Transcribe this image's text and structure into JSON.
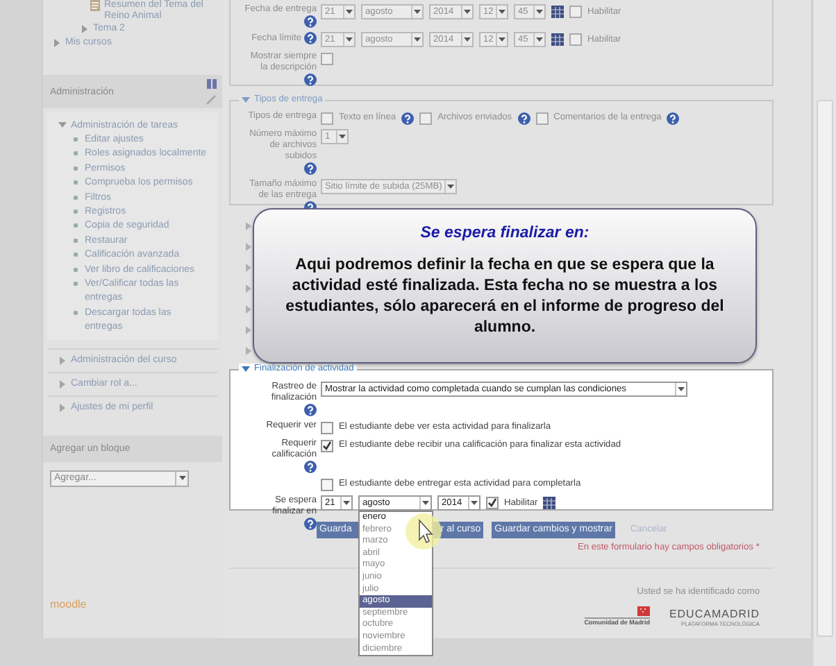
{
  "sidebar": {
    "nav_items": [
      {
        "kind": "resource",
        "label": "Resumen del Tema del Reino Animal"
      },
      {
        "kind": "topic",
        "label": "Tema 2",
        "expanded": false
      },
      {
        "kind": "branch",
        "label": "Mis cursos",
        "expanded": false
      }
    ],
    "admin_block": {
      "title": "Administración",
      "groups": [
        {
          "label": "Administración de tareas",
          "expanded": true,
          "children": [
            {
              "label": "Editar ajustes"
            },
            {
              "label": "Roles asignados localmente"
            },
            {
              "label": "Permisos"
            },
            {
              "label": "Comprueba los permisos"
            },
            {
              "label": "Filtros"
            },
            {
              "label": "Registros"
            },
            {
              "label": "Copia de seguridad"
            },
            {
              "label": "Restaurar"
            },
            {
              "label": "Calificación avanzada"
            },
            {
              "label": "Ver libro de calificaciones"
            },
            {
              "label": "Ver/Calificar todas las entregas"
            },
            {
              "label": "Descargar todas las entregas"
            }
          ]
        },
        {
          "label": "Administración del curso",
          "expanded": false
        },
        {
          "label": "Cambiar rol a...",
          "expanded": false
        },
        {
          "label": "Ajustes de mi perfil",
          "expanded": false
        }
      ]
    },
    "add_block": {
      "title": "Agregar un bloque",
      "select": "Agregar..."
    },
    "logo": "moodle"
  },
  "main": {
    "due_dates": {
      "rows": [
        {
          "label": "Fecha de entrega",
          "help": true,
          "day": "21",
          "month": "agosto",
          "year": "2014",
          "hour": "12",
          "minute": "45",
          "enabled": false,
          "enable_label": "Habilitar"
        },
        {
          "label": "Fecha límite",
          "help": true,
          "day": "21",
          "month": "agosto",
          "year": "2014",
          "hour": "12",
          "minute": "45",
          "enabled": false,
          "enable_label": "Habilitar"
        }
      ],
      "show_description": {
        "label": "Mostrar siempre la descripción",
        "help": true,
        "checked": false
      }
    },
    "submission_types": {
      "legend": "Tipos de entrega",
      "expanded": true,
      "types_label": "Tipos de entrega",
      "types": [
        {
          "label": "Texto en línea",
          "checked": false
        },
        {
          "label": "Archivos enviados",
          "checked": false
        },
        {
          "label": "Comentarios de la entrega",
          "checked": false
        }
      ],
      "max_files": {
        "label": "Número máximo de archivos subidos",
        "value": "1"
      },
      "max_size": {
        "label": "Tamaño máximo de las entrega",
        "value": "Sitio límite de subida (25MB)"
      }
    },
    "hidden_sections": [
      {
        "expanded": false
      },
      {
        "expanded": false
      },
      {
        "expanded": false
      },
      {
        "expanded": false
      },
      {
        "expanded": false
      },
      {
        "expanded": false
      },
      {
        "expanded": false
      }
    ],
    "tooltip": {
      "title": "Se espera finalizar en:",
      "body": "Aqui podremos definir la fecha en que se espera que la actividad esté finalizada. Esta fecha no se muestra a los estudiantes, sólo aparecerá en el informe de progreso del alumno."
    },
    "completion": {
      "legend": "Finalización de actividad",
      "expanded": true,
      "rows": [
        {
          "kind": "select",
          "label": "Rastreo de finalización",
          "help": true,
          "value": "Mostrar la actividad como completada cuando se cumplan las condiciones"
        },
        {
          "kind": "checkbox",
          "label": "Requerir ver",
          "help": false,
          "checked": false,
          "text": "El estudiante debe ver esta actividad para finalizarla"
        },
        {
          "kind": "checkbox",
          "label": "Requerir calificación",
          "help": true,
          "checked": true,
          "text": "El estudiante debe recibir una calificación para finalizar esta actividad"
        },
        {
          "kind": "checkbox",
          "help": false,
          "checked": false,
          "text": "El estudiante debe entregar esta actividad para completarla"
        },
        {
          "kind": "date",
          "label": "Se espera finalizar en",
          "help": true,
          "day": "21",
          "month": "agosto",
          "year": "2014",
          "enabled": true,
          "enable_label": "Habilitar"
        }
      ],
      "month_dropdown": {
        "options": [
          {
            "label": "enero",
            "selected": false
          },
          {
            "label": "febrero",
            "selected": false
          },
          {
            "label": "marzo",
            "selected": false
          },
          {
            "label": "abril",
            "selected": false
          },
          {
            "label": "mayo",
            "selected": false
          },
          {
            "label": "junio",
            "selected": false
          },
          {
            "label": "julio",
            "selected": false
          },
          {
            "label": "agosto",
            "selected": true
          },
          {
            "label": "septiembre",
            "selected": false
          },
          {
            "label": "octubre",
            "selected": false
          },
          {
            "label": "noviembre",
            "selected": false
          },
          {
            "label": "diciembre",
            "selected": false
          }
        ]
      }
    },
    "buttons": [
      {
        "kind": "partial",
        "label_start": "Guarda",
        "label_end": "r al curso"
      },
      {
        "kind": "full",
        "label": "Guardar cambios y mostrar"
      },
      {
        "kind": "link",
        "label": "Cancelar"
      }
    ],
    "required_note": {
      "text": "En este formulario hay campos obligatorios",
      "mark": "*"
    },
    "footer": {
      "login_text": "Usted se ha identificado como",
      "region_logo": "Comunidad de Madrid",
      "platform_logo": "EDUCAMADRID",
      "platform_tagline": "PLATAFORMA TECNOLÓGICA"
    }
  }
}
